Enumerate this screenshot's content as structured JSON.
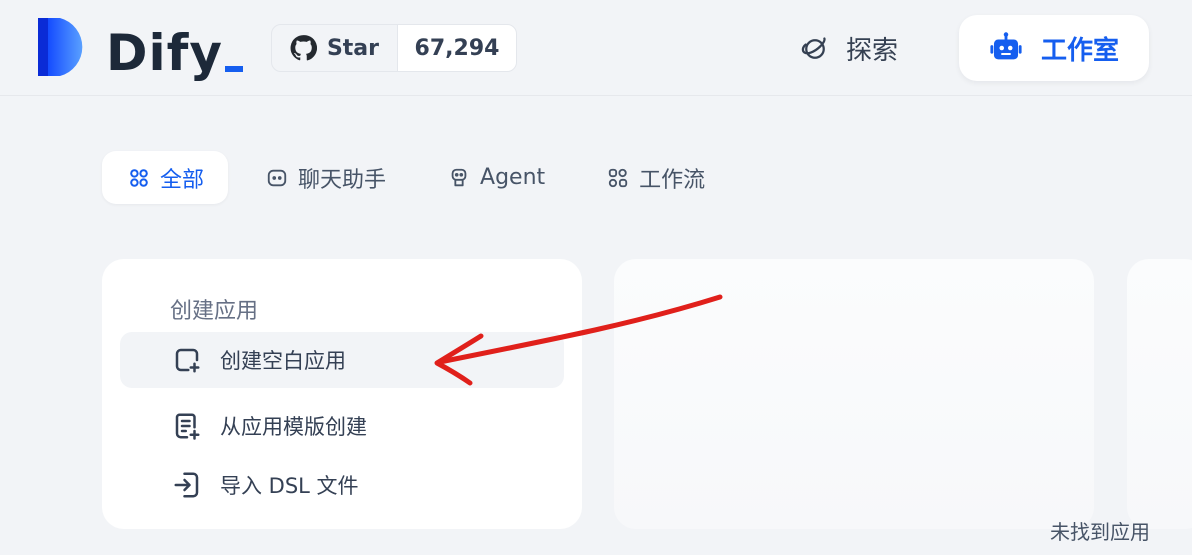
{
  "header": {
    "logo_text": "Dify",
    "github": {
      "label": "Star",
      "count": "67,294"
    },
    "explore_label": "探索",
    "studio_label": "工作室"
  },
  "tabs": [
    {
      "label": "全部",
      "icon": "grid-icon",
      "active": true
    },
    {
      "label": "聊天助手",
      "icon": "chat-bubble-icon",
      "active": false
    },
    {
      "label": "Agent",
      "icon": "agent-icon",
      "active": false
    },
    {
      "label": "工作流",
      "icon": "workflow-icon",
      "active": false
    }
  ],
  "create": {
    "title": "创建应用",
    "items": [
      {
        "label": "创建空白应用",
        "icon": "file-plus-icon"
      },
      {
        "label": "从应用模版创建",
        "icon": "template-icon"
      },
      {
        "label": "导入 DSL 文件",
        "icon": "import-icon"
      }
    ]
  },
  "empty_state": "未找到应用",
  "colors": {
    "accent": "#155eef",
    "annotation": "#e0201b",
    "background": "#f2f4f7"
  }
}
